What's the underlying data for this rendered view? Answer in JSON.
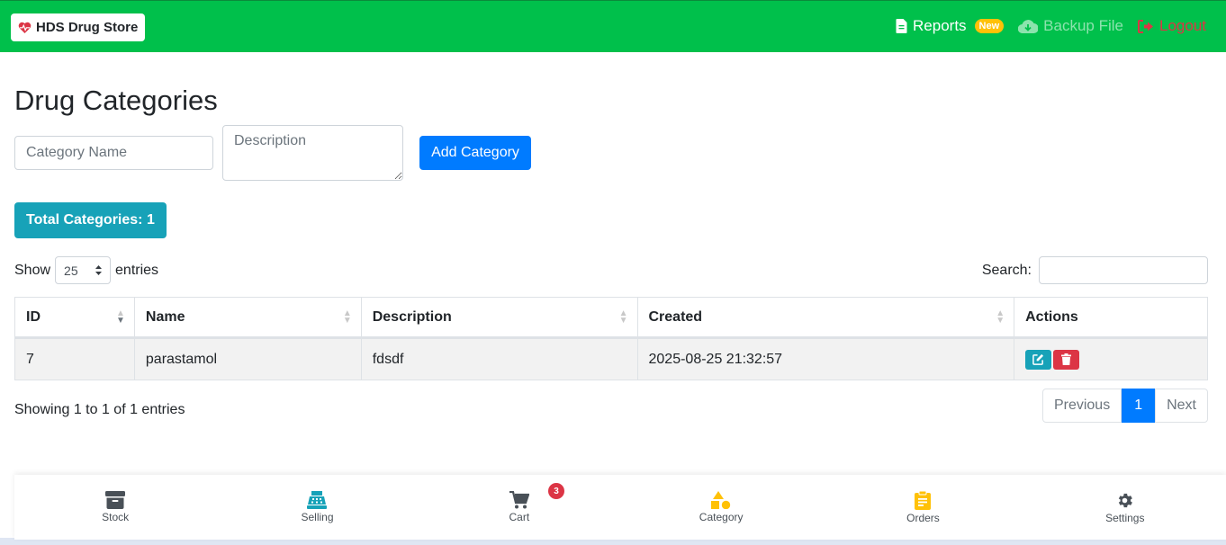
{
  "navbar": {
    "brand": "HDS Drug Store",
    "reports": "Reports",
    "reports_badge": "New",
    "backup": "Backup File",
    "logout": "Logout"
  },
  "page": {
    "title": "Drug Categories"
  },
  "form": {
    "name_placeholder": "Category Name",
    "description_placeholder": "Description",
    "add_button": "Add Category"
  },
  "summary": {
    "total_label": "Total Categories: 1"
  },
  "table_controls": {
    "show_label": "Show",
    "page_size": "25",
    "entries_label": "entries",
    "search_label": "Search:"
  },
  "table": {
    "columns": [
      "ID",
      "Name",
      "Description",
      "Created",
      "Actions"
    ],
    "rows": [
      {
        "id": "7",
        "name": "parastamol",
        "description": "fdsdf",
        "created": "2025-08-25 21:32:57"
      }
    ]
  },
  "pagination": {
    "info": "Showing 1 to 1 of 1 entries",
    "previous": "Previous",
    "current": "1",
    "next": "Next"
  },
  "bottom_nav": {
    "items": [
      {
        "label": "Stock",
        "icon": "archive-box-icon",
        "color": "#495057"
      },
      {
        "label": "Selling",
        "icon": "cash-register-icon",
        "color": "#17a2b8"
      },
      {
        "label": "Cart",
        "icon": "shopping-cart-icon",
        "color": "#495057"
      },
      {
        "label": "Category",
        "icon": "shapes-icon",
        "color": "#ffc107"
      },
      {
        "label": "Orders",
        "icon": "clipboard-icon",
        "color": "#ffc107"
      },
      {
        "label": "Settings",
        "icon": "gear-icon",
        "color": "#495057"
      }
    ],
    "cart_badge": "3"
  },
  "colors": {
    "navbar": "#00c04b",
    "primary": "#007bff",
    "info": "#17a2b8",
    "danger": "#dc3545",
    "warning": "#ffc107"
  }
}
